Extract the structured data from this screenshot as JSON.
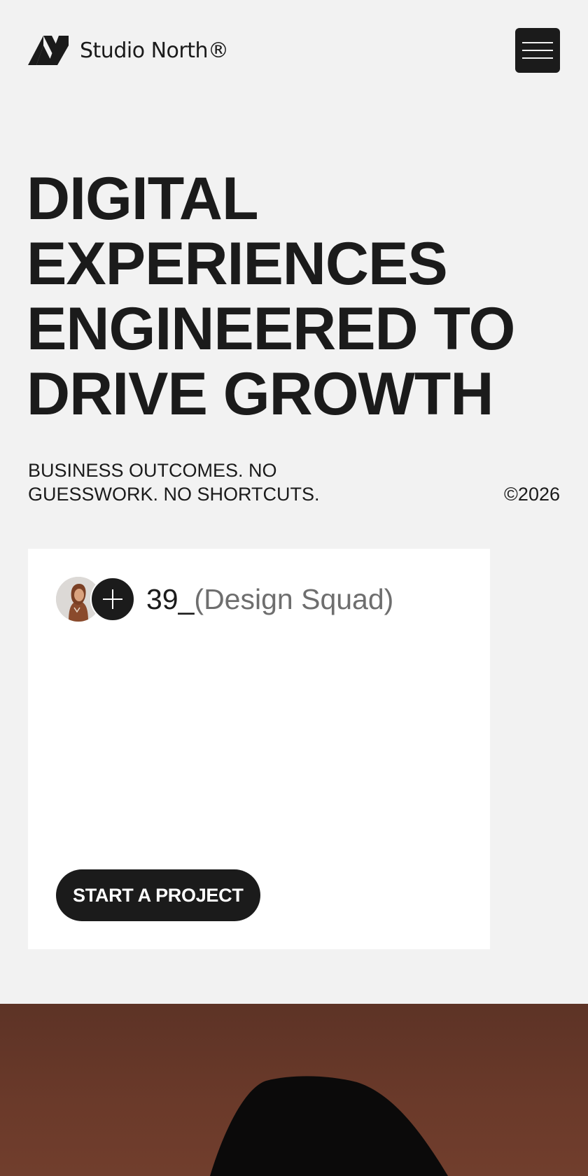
{
  "header": {
    "brand_name": "Studio North®",
    "logo_icon": "studio-north-logo-icon",
    "menu_icon": "hamburger-menu-icon"
  },
  "hero": {
    "lines": [
      "DIGITAL",
      "EXPERIENCES",
      "ENGINEERED TO",
      "DRIVE GROWTH"
    ]
  },
  "tagline": {
    "line1": "BUSINESS OUTCOMES. NO",
    "line2": "GUESSWORK. NO SHORTCUTS."
  },
  "copyright": "©2026",
  "card": {
    "team_count": "39_",
    "team_label": "(Design Squad)",
    "cta_label": "START A PROJECT",
    "add_icon": "plus-icon"
  },
  "colors": {
    "background": "#f2f2f2",
    "ink": "#1b1b1b",
    "card": "#ffffff",
    "muted": "#6e6e6e",
    "media_bg": "#643728"
  }
}
